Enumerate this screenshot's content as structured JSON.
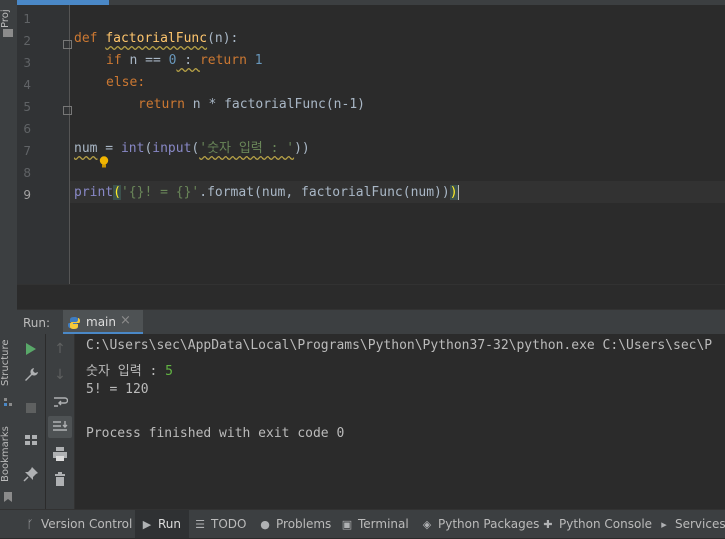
{
  "left_strip": {
    "project_label": "Proj",
    "structure_label": "Structure",
    "bookmarks_label": "Bookmarks"
  },
  "editor": {
    "line_numbers": [
      "1",
      "2",
      "3",
      "4",
      "5",
      "6",
      "7",
      "8",
      "9"
    ],
    "current_line": "9",
    "lines": {
      "l2": {
        "kw": "def",
        "fn": "factorialFunc",
        "rest": "(n):"
      },
      "l3": {
        "kw1": "if",
        "mid": " n == ",
        "num": "0",
        "colon": " : ",
        "kw2": "return",
        "num2": "1"
      },
      "l4": {
        "kw": "else",
        "rest": ":"
      },
      "l5": {
        "kw": "return",
        "rest": " n * factorialFunc(n-1)"
      },
      "l7": {
        "var": "num",
        "eq": " = ",
        "bi1": "int",
        "p1": "(",
        "bi2": "input",
        "p2": "(",
        "str": "'숫자 입력 : '",
        "p3": "))"
      },
      "l9": {
        "bi": "print",
        "p1": "(",
        "str": "'{}! = {}'",
        "rest": ".format(num, factorialFunc(num))",
        "p2": ")"
      }
    }
  },
  "run_panel": {
    "label": "Run:",
    "tab_name": "main",
    "console_lines": {
      "cmd": "C:\\Users\\sec\\AppData\\Local\\Programs\\Python\\Python37-32\\python.exe C:\\Users\\sec\\P",
      "prompt": "숫자 입력 : ",
      "input": "5",
      "result": "5! = 120",
      "finished": "Process finished with exit code 0"
    }
  },
  "bottom_tabs": [
    {
      "label": "Version Control",
      "icon": "branch-icon"
    },
    {
      "label": "Run",
      "icon": "run-icon"
    },
    {
      "label": "TODO",
      "icon": "list-icon"
    },
    {
      "label": "Problems",
      "icon": "problems-icon"
    },
    {
      "label": "Terminal",
      "icon": "terminal-icon"
    },
    {
      "label": "Python Packages",
      "icon": "packages-icon"
    },
    {
      "label": "Python Console",
      "icon": "python-icon"
    },
    {
      "label": "Services",
      "icon": "services-icon"
    }
  ],
  "colors": {
    "keyword": "#cc7832",
    "function": "#ffc66d",
    "number": "#6897bb",
    "string": "#6a8759",
    "builtin": "#8888c6",
    "user_input": "#62b543",
    "run_green": "#59a869"
  }
}
